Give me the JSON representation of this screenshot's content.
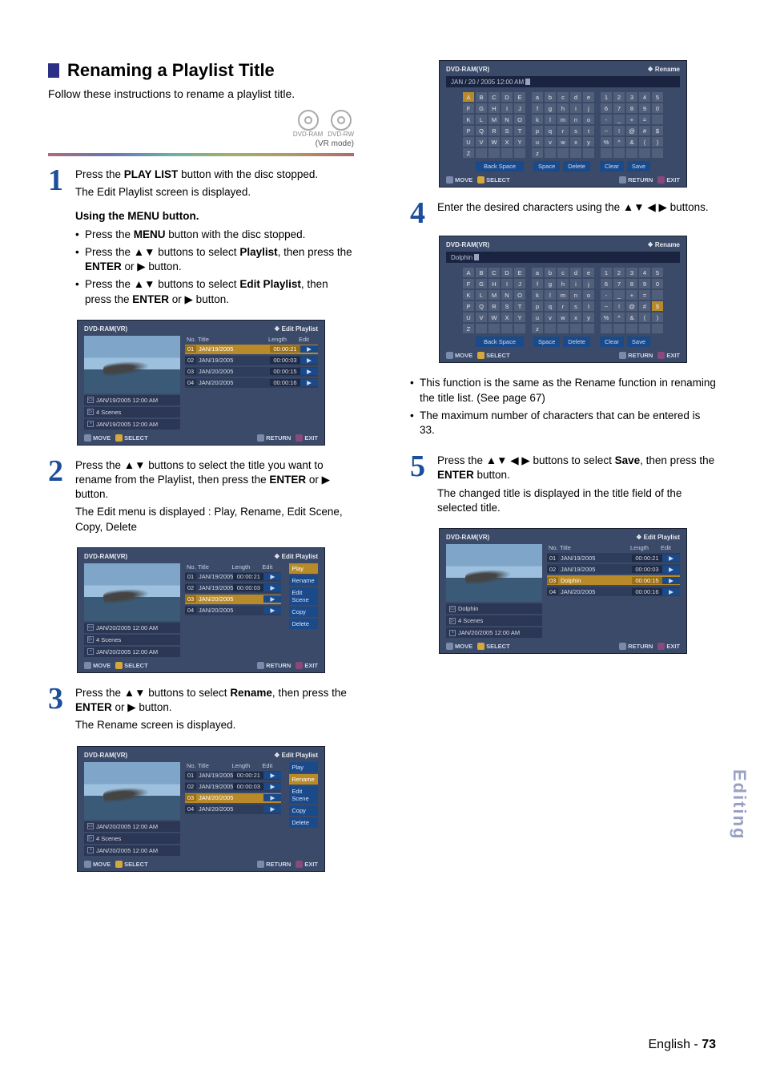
{
  "heading": "Renaming a Playlist Title",
  "intro": "Follow these instructions to rename a playlist title.",
  "discs": {
    "ram": "DVD-RAM",
    "rw": "DVD-RW",
    "vrmode": "(VR mode)"
  },
  "side_tab": "Editing",
  "footer": {
    "lang": "English",
    "sep": " - ",
    "page": "73"
  },
  "step1": {
    "num": "1",
    "p1a": "Press the ",
    "p1b": "PLAY LIST",
    "p1c": " button with the disc stopped.",
    "p2": "The Edit Playlist screen is displayed.",
    "menu_h": "Using the MENU button.",
    "b1a": "Press the ",
    "b1b": "MENU",
    "b1c": " button with the disc stopped.",
    "b2a": "Press the ▲▼ buttons to select ",
    "b2b": "Playlist",
    "b2c": ", then press the ",
    "b2d": "ENTER",
    "b2e": " or ▶ button.",
    "b3a": "Press the ▲▼ buttons to select ",
    "b3b": "Edit Playlist",
    "b3c": ", then press the ",
    "b3d": "ENTER",
    "b3e": " or ▶ button."
  },
  "step2": {
    "num": "2",
    "p1a": "Press the ▲▼ buttons to select the title you want to rename from the Playlist, then press the ",
    "p1b": "ENTER",
    "p1c": " or ▶ button.",
    "p2": "The Edit menu is displayed : Play, Rename, Edit Scene, Copy, Delete"
  },
  "step3": {
    "num": "3",
    "p1a": "Press the  ▲▼ buttons to select ",
    "p1b": "Rename",
    "p1c": ", then press the ",
    "p1d": "ENTER",
    "p1e": " or ▶ button.",
    "p2": "The Rename screen is displayed."
  },
  "step4": {
    "num": "4",
    "p1": "Enter the desired characters using the ▲▼ ◀ ▶ buttons.",
    "n1": "This function is the same as the Rename function in renaming the title list. (See page 67)",
    "n2": "The maximum number of characters that can be entered is 33."
  },
  "step5": {
    "num": "5",
    "p1a": "Press the ▲▼ ◀ ▶ buttons to select ",
    "p1b": "Save",
    "p1c": ", then press the ",
    "p1d": "ENTER",
    "p1e": " button.",
    "p2": "The changed title is displayed in the title field of the selected title."
  },
  "osd_common": {
    "device": "DVD-RAM(VR)",
    "mode_edit": "Edit Playlist",
    "mode_rename": "Rename",
    "foot_move": "MOVE",
    "foot_select": "SELECT",
    "foot_return": "RETURN",
    "foot_exit": "EXIT",
    "head_no": "No.",
    "head_title": "Title",
    "head_len": "Length",
    "head_edit": "Edit",
    "meta_scenes": "4 Scenes"
  },
  "osd1": {
    "rows": [
      {
        "no": "01",
        "title": "JAN/19/2005",
        "len": "00:00:21",
        "sel": true
      },
      {
        "no": "02",
        "title": "JAN/19/2005",
        "len": "00:00:03"
      },
      {
        "no": "03",
        "title": "JAN/20/2005",
        "len": "00:00:15"
      },
      {
        "no": "04",
        "title": "JAN/20/2005",
        "len": "00:00:16"
      }
    ],
    "m1": "JAN/19/2005 12:00 AM",
    "m3": "JAN/19/2005 12:00 AM"
  },
  "osd2": {
    "rows": [
      {
        "no": "01",
        "title": "JAN/19/2005",
        "len": "00:00:21"
      },
      {
        "no": "02",
        "title": "JAN/19/2005",
        "len": "00:00:03"
      },
      {
        "no": "03",
        "title": "JAN/20/2005",
        "len": "",
        "sel": true
      },
      {
        "no": "04",
        "title": "JAN/20/2005",
        "len": ""
      }
    ],
    "menu": [
      "Play",
      "Rename",
      "Edit Scene",
      "Copy",
      "Delete"
    ],
    "menu_sel": 0,
    "m1": "JAN/20/2005 12:00 AM",
    "m3": "JAN/20/2005 12:00 AM"
  },
  "osd3": {
    "rows": [
      {
        "no": "01",
        "title": "JAN/19/2005",
        "len": "00:00:21"
      },
      {
        "no": "02",
        "title": "JAN/19/2005",
        "len": "00:00:03"
      },
      {
        "no": "03",
        "title": "JAN/20/2005",
        "len": "",
        "sel": true
      },
      {
        "no": "04",
        "title": "JAN/20/2005",
        "len": ""
      }
    ],
    "menu": [
      "Play",
      "Rename",
      "Edit Scene",
      "Copy",
      "Delete"
    ],
    "menu_sel": 1,
    "m1": "JAN/20/2005 12:00 AM",
    "m3": "JAN/20/2005 12:00 AM"
  },
  "osd4a": {
    "input": "JAN / 20 / 2005  12:00  AM",
    "upper": [
      [
        "A",
        "B",
        "C",
        "D",
        "E"
      ],
      [
        "F",
        "G",
        "H",
        "I",
        "J"
      ],
      [
        "K",
        "L",
        "M",
        "N",
        "O"
      ],
      [
        "P",
        "Q",
        "R",
        "S",
        "T"
      ],
      [
        "U",
        "V",
        "W",
        "X",
        "Y"
      ],
      [
        "Z",
        "",
        "",
        "",
        ""
      ]
    ],
    "lower": [
      [
        "a",
        "b",
        "c",
        "d",
        "e"
      ],
      [
        "f",
        "g",
        "h",
        "i",
        "j"
      ],
      [
        "k",
        "l",
        "m",
        "n",
        "o"
      ],
      [
        "p",
        "q",
        "r",
        "s",
        "t"
      ],
      [
        "u",
        "v",
        "w",
        "x",
        "y"
      ],
      [
        "z",
        "",
        "",
        "",
        ""
      ]
    ],
    "nums": [
      [
        "1",
        "2",
        "3",
        "4",
        "5"
      ],
      [
        "6",
        "7",
        "8",
        "9",
        "0"
      ],
      [
        "-",
        "_",
        "+",
        "=",
        ""
      ],
      [
        "~",
        "!",
        "@",
        "#",
        "$"
      ],
      [
        "%",
        "^",
        "&",
        "(",
        ")"
      ],
      [
        "",
        "",
        "",
        "",
        ""
      ]
    ],
    "actions": {
      "backspace": "Back Space",
      "space": "Space",
      "delete": "Delete",
      "clear": "Clear",
      "save": "Save"
    },
    "sel": [
      0,
      0
    ]
  },
  "osd4b": {
    "input": "Dolphin",
    "sel_block": 2,
    "sel": [
      3,
      4
    ]
  },
  "osd5": {
    "rows": [
      {
        "no": "01",
        "title": "JAN/19/2005",
        "len": "00:00:21"
      },
      {
        "no": "02",
        "title": "JAN/19/2005",
        "len": "00:00:03"
      },
      {
        "no": "03",
        "title": "Dolphin",
        "len": "00:00:15",
        "sel": true
      },
      {
        "no": "04",
        "title": "JAN/20/2005",
        "len": "00:00:16"
      }
    ],
    "m1": "Dolphin",
    "m3": "JAN/20/2005 12:00 AM"
  }
}
